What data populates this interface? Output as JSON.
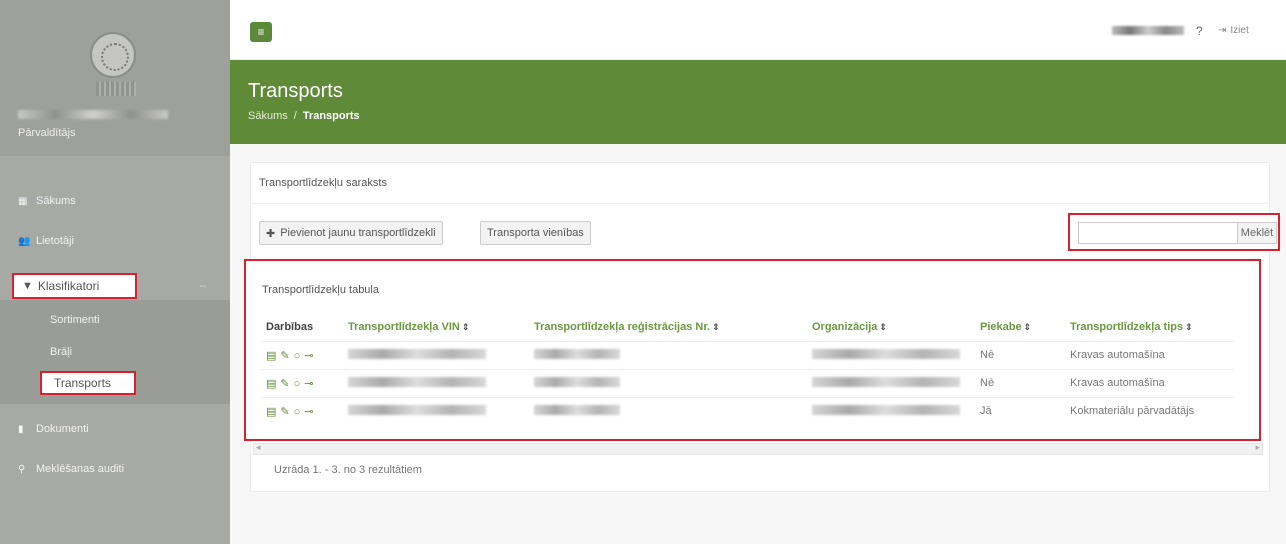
{
  "sidebar": {
    "role": "Pārvaldītājs",
    "items": [
      {
        "label": "Sākums",
        "icon": "dashboard-icon"
      },
      {
        "label": "Lietotāji",
        "icon": "users-icon"
      },
      {
        "label": "Klasifikatori",
        "icon": "filter-icon"
      },
      {
        "label": "Dokumenti",
        "icon": "file-icon"
      },
      {
        "label": "Meklēšanas auditi",
        "icon": "search-icon"
      }
    ],
    "subitems": [
      "Sortimenti",
      "Brāļi",
      "Transports"
    ]
  },
  "topbar": {
    "menu_icon": "≡",
    "help_icon": "?",
    "logout_label": "Iziet"
  },
  "header": {
    "title": "Transports",
    "breadcrumb_home": "Sākums",
    "breadcrumb_sep": "/",
    "breadcrumb_current": "Transports"
  },
  "card": {
    "title": "Transportlīdzekļu saraksts",
    "add_button": "Pievienot jaunu transportlīdzekli",
    "units_button": "Transporta vienības",
    "search_button": "Meklēt",
    "search_placeholder": ""
  },
  "table": {
    "title": "Transportlīdzekļu tabula",
    "columns": [
      "Darbības",
      "Transportlīdzekļa VIN",
      "Transportlīdzekļa reģistrācijas Nr.",
      "Organizācija",
      "Piekabe",
      "Transportlīdzekļa tips"
    ],
    "rows": [
      {
        "trailer": "Nē",
        "type": "Kravas automašīna"
      },
      {
        "trailer": "Nē",
        "type": "Kravas automašīna"
      },
      {
        "trailer": "Jā",
        "type": "Kokmateriālu pārvadātājs"
      }
    ],
    "summary": "Uzrāda 1. - 3. no 3 rezultātiem"
  },
  "colors": {
    "accent": "#5f8a37",
    "highlight": "#d72030",
    "sidebar": "#a7a9a5"
  }
}
